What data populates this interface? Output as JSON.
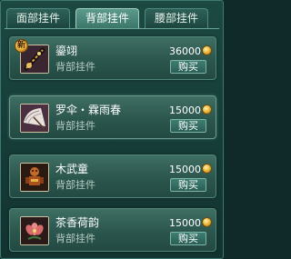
{
  "tabs": [
    {
      "label": "面部挂件",
      "active": false
    },
    {
      "label": "背部挂件",
      "active": true
    },
    {
      "label": "腰部挂件",
      "active": false
    }
  ],
  "items": [
    {
      "name": "鎏翊",
      "category": "背部挂件",
      "price": "36000",
      "buy_label": "购买",
      "new_badge": "新",
      "icon": "sword-icon"
    },
    {
      "name": "罗伞・霖雨春",
      "category": "背部挂件",
      "price": "15000",
      "buy_label": "购买",
      "icon": "umbrella-icon"
    },
    {
      "name": "木武童",
      "category": "背部挂件",
      "price": "15000",
      "buy_label": "购买",
      "icon": "wooden-doll-icon"
    },
    {
      "name": "茶香荷韵",
      "category": "背部挂件",
      "price": "15000",
      "buy_label": "购买",
      "icon": "lotus-icon"
    }
  ],
  "colors": {
    "accent": "#5c9a8c",
    "coin": "#e9b535",
    "panel": "#1d4943"
  }
}
